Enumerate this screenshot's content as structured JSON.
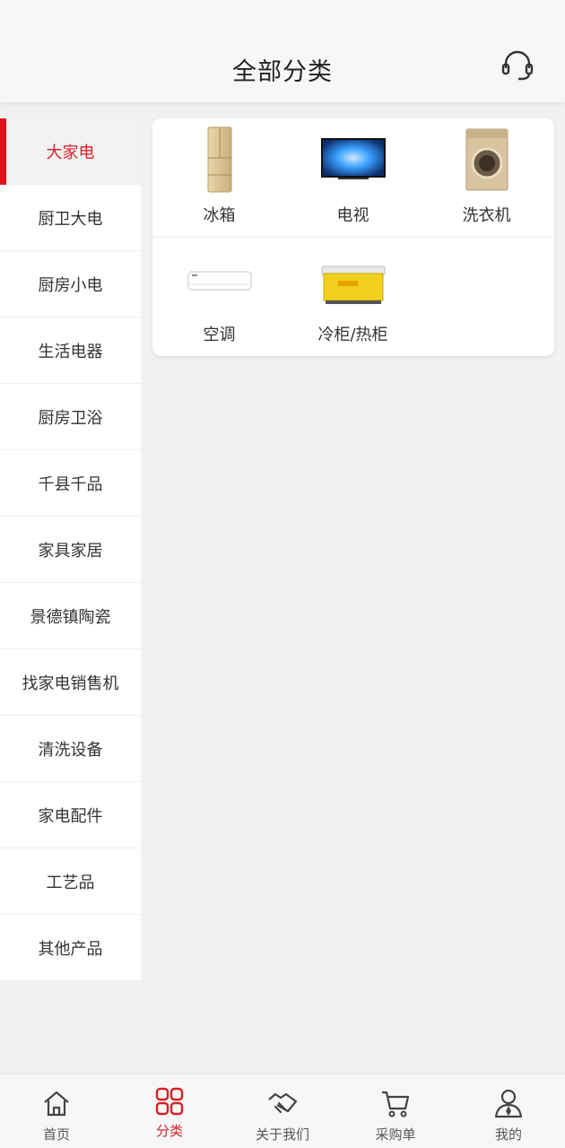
{
  "header": {
    "title": "全部分类",
    "service_icon": "headset-icon"
  },
  "sidebar": {
    "items": [
      {
        "label": "大家电",
        "active": true
      },
      {
        "label": "厨卫大电"
      },
      {
        "label": "厨房小电"
      },
      {
        "label": "生活电器"
      },
      {
        "label": "厨房卫浴"
      },
      {
        "label": "千县千品"
      },
      {
        "label": "家具家居"
      },
      {
        "label": "景德镇陶瓷"
      },
      {
        "label": "找家电销售机"
      },
      {
        "label": "清洗设备"
      },
      {
        "label": "家电配件"
      },
      {
        "label": "工艺品"
      },
      {
        "label": "其他产品"
      }
    ]
  },
  "categories": [
    {
      "label": "冰箱",
      "icon": "refrigerator-image"
    },
    {
      "label": "电视",
      "icon": "tv-image"
    },
    {
      "label": "洗衣机",
      "icon": "washing-machine-image"
    },
    {
      "label": "空调",
      "icon": "air-conditioner-image"
    },
    {
      "label": "冷柜/热柜",
      "icon": "freezer-image"
    }
  ],
  "tabbar": {
    "items": [
      {
        "label": "首页",
        "icon": "home-icon"
      },
      {
        "label": "分类",
        "icon": "category-grid-icon",
        "active": true
      },
      {
        "label": "关于我们",
        "icon": "handshake-icon"
      },
      {
        "label": "采购单",
        "icon": "cart-icon"
      },
      {
        "label": "我的",
        "icon": "user-icon"
      }
    ]
  },
  "colors": {
    "accent": "#d61f26",
    "background": "#f2f1f2"
  }
}
